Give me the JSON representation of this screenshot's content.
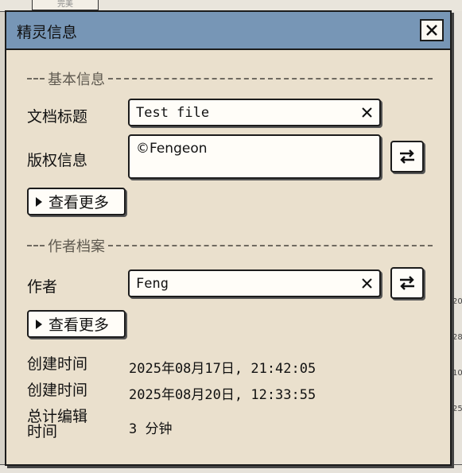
{
  "background": {
    "top_tab_label": "完美",
    "right_ticks": [
      "20",
      "28",
      "10",
      "25"
    ]
  },
  "dialog": {
    "title": "精灵信息",
    "close_icon": "close-icon",
    "basic_section": {
      "header": "基本信息",
      "title_label": "文档标题",
      "title_value": "Test file",
      "copyright_label": "版权信息",
      "copyright_value": "©Fengeon",
      "more_label": "查看更多"
    },
    "author_section": {
      "header": "作者档案",
      "author_label": "作者",
      "author_value": "Feng",
      "more_label": "查看更多"
    },
    "stats": [
      {
        "label": "创建时间",
        "value": "2025年08月17日, 21:42:05"
      },
      {
        "label": "创建时间",
        "value": "2025年08月20日, 12:33:55"
      },
      {
        "label": "总计编辑时间",
        "value": "3 分钟"
      }
    ]
  },
  "colors": {
    "titlebar": "#7796b6",
    "dialog_bg": "#eae0cd"
  }
}
